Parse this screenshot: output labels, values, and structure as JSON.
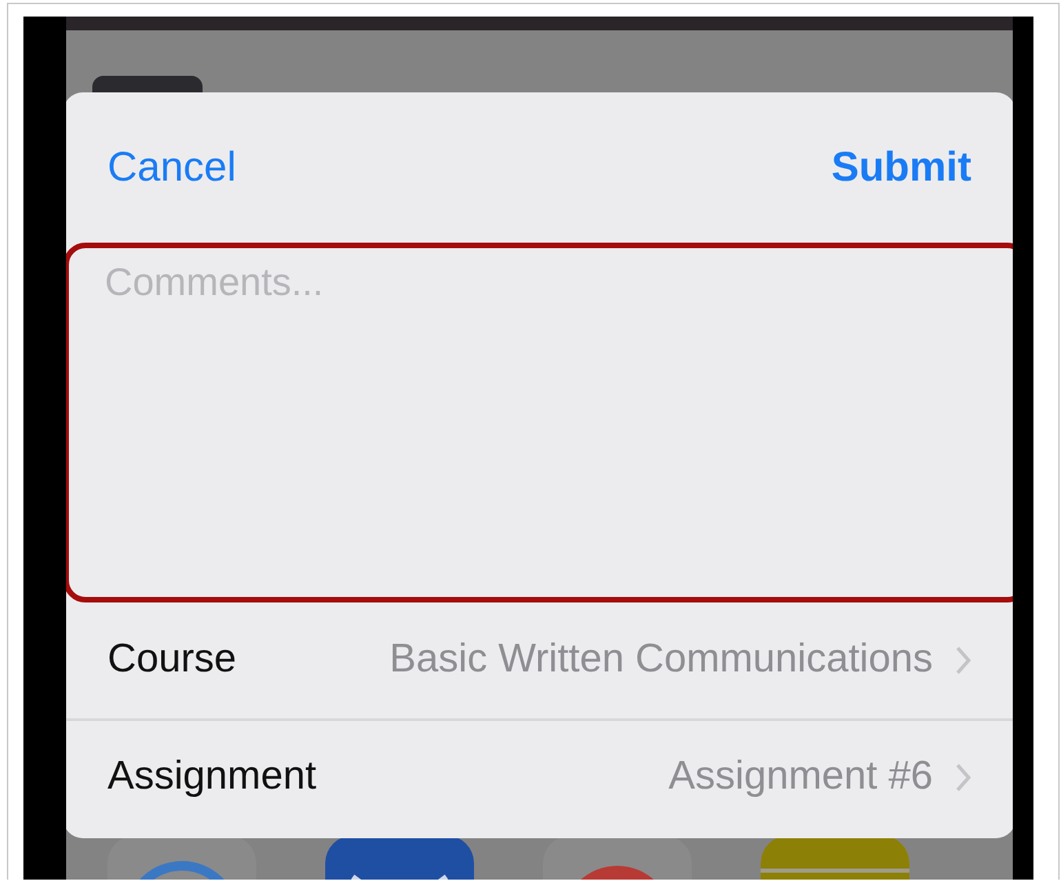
{
  "sheet": {
    "cancel": "Cancel",
    "submit": "Submit",
    "comments": {
      "placeholder": "Comments...",
      "highlighted": true
    },
    "rows": [
      {
        "label": "Course",
        "value": "Basic Written Communications"
      },
      {
        "label": "Assignment",
        "value": "Assignment #6"
      }
    ]
  }
}
